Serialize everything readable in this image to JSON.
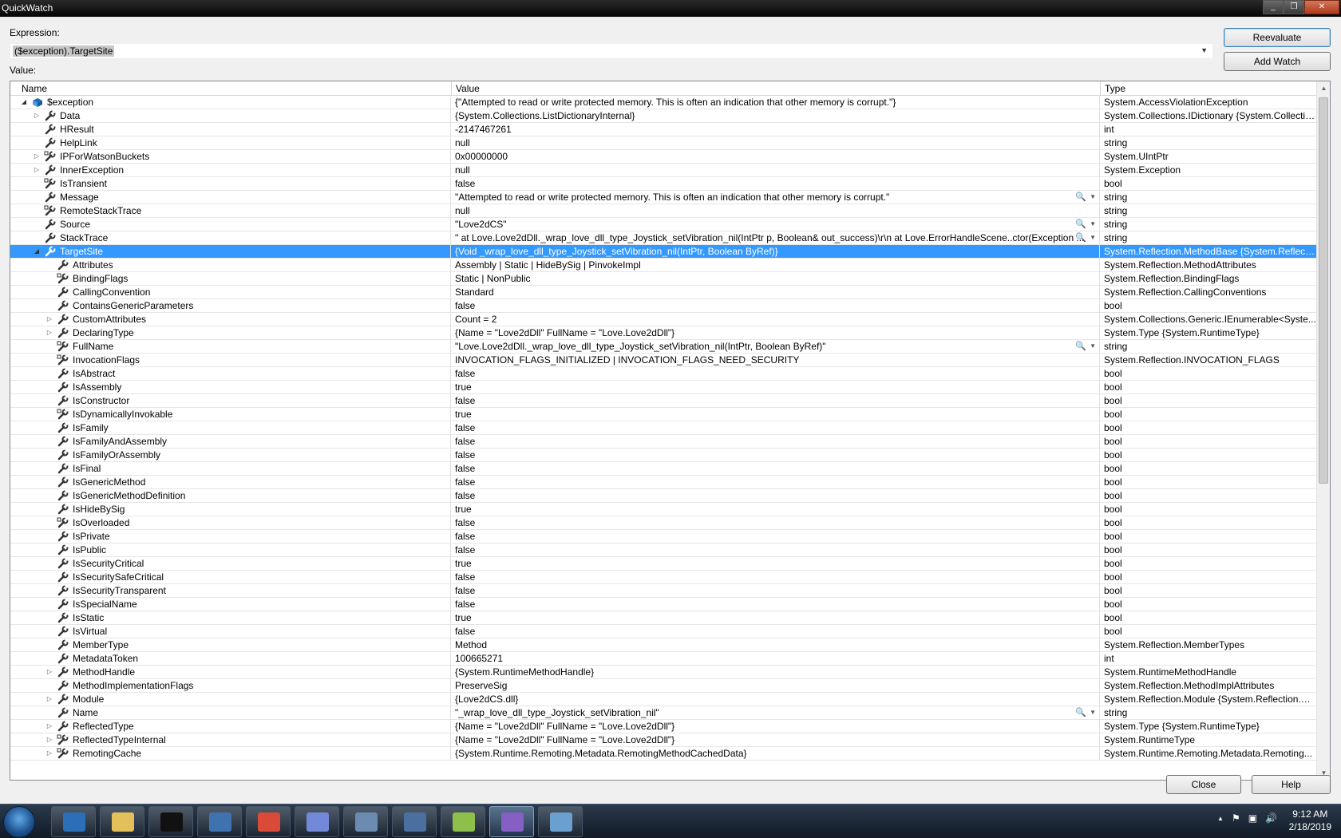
{
  "window": {
    "title": "QuickWatch",
    "btn_min": "_",
    "btn_max": "❐",
    "btn_close": "✕"
  },
  "expression": {
    "label": "Expression:",
    "value": "($exception).TargetSite"
  },
  "buttons": {
    "reevaluate": "Reevaluate",
    "add_watch": "Add Watch",
    "close": "Close",
    "help": "Help"
  },
  "value_label": "Value:",
  "columns": {
    "name": "Name",
    "value": "Value",
    "type": "Type"
  },
  "rows": [
    {
      "name": "$exception",
      "value": "{\"Attempted to read or write protected memory. This is often an indication that other memory is corrupt.\"}",
      "type": "System.AccessViolationException",
      "indent": 0,
      "expander": "open",
      "icon": "exception"
    },
    {
      "name": "Data",
      "value": "{System.Collections.ListDictionaryInternal}",
      "type": "System.Collections.IDictionary {System.Collectio...",
      "indent": 1,
      "expander": "closed",
      "icon": "property"
    },
    {
      "name": "HResult",
      "value": "-2147467261",
      "type": "int",
      "indent": 1,
      "expander": "",
      "icon": "property"
    },
    {
      "name": "HelpLink",
      "value": "null",
      "type": "string",
      "indent": 1,
      "expander": "",
      "icon": "property"
    },
    {
      "name": "IPForWatsonBuckets",
      "value": "0x00000000",
      "type": "System.UIntPtr",
      "indent": 1,
      "expander": "closed",
      "icon": "property-private"
    },
    {
      "name": "InnerException",
      "value": "null",
      "type": "System.Exception",
      "indent": 1,
      "expander": "closed",
      "icon": "property"
    },
    {
      "name": "IsTransient",
      "value": "false",
      "type": "bool",
      "indent": 1,
      "expander": "",
      "icon": "property-private"
    },
    {
      "name": "Message",
      "value": "\"Attempted to read or write protected memory. This is often an indication that other memory is corrupt.\"",
      "type": "string",
      "indent": 1,
      "expander": "",
      "icon": "property",
      "viz": true
    },
    {
      "name": "RemoteStackTrace",
      "value": "null",
      "type": "string",
      "indent": 1,
      "expander": "",
      "icon": "property-private"
    },
    {
      "name": "Source",
      "value": "\"Love2dCS\"",
      "type": "string",
      "indent": 1,
      "expander": "",
      "icon": "property",
      "viz": true
    },
    {
      "name": "StackTrace",
      "value": "\"   at Love.Love2dDll._wrap_love_dll_type_Joystick_setVibration_nil(IntPtr p, Boolean& out_success)\\r\\n   at Love.ErrorHandleScene..ctor(Exception ...",
      "type": "string",
      "indent": 1,
      "expander": "",
      "icon": "property",
      "viz": true
    },
    {
      "name": "TargetSite",
      "value": "{Void _wrap_love_dll_type_Joystick_setVibration_nil(IntPtr, Boolean ByRef)}",
      "type": "System.Reflection.MethodBase {System.Reflectio...",
      "indent": 1,
      "expander": "open",
      "icon": "property",
      "selected": true
    },
    {
      "name": "Attributes",
      "value": "Assembly | Static | HideBySig | PinvokeImpl",
      "type": "System.Reflection.MethodAttributes",
      "indent": 2,
      "expander": "",
      "icon": "property"
    },
    {
      "name": "BindingFlags",
      "value": "Static | NonPublic",
      "type": "System.Reflection.BindingFlags",
      "indent": 2,
      "expander": "",
      "icon": "property-private"
    },
    {
      "name": "CallingConvention",
      "value": "Standard",
      "type": "System.Reflection.CallingConventions",
      "indent": 2,
      "expander": "",
      "icon": "property"
    },
    {
      "name": "ContainsGenericParameters",
      "value": "false",
      "type": "bool",
      "indent": 2,
      "expander": "",
      "icon": "property"
    },
    {
      "name": "CustomAttributes",
      "value": "Count = 2",
      "type": "System.Collections.Generic.IEnumerable<Syste...",
      "indent": 2,
      "expander": "closed",
      "icon": "property"
    },
    {
      "name": "DeclaringType",
      "value": "{Name = \"Love2dDll\" FullName = \"Love.Love2dDll\"}",
      "type": "System.Type {System.RuntimeType}",
      "indent": 2,
      "expander": "closed",
      "icon": "property"
    },
    {
      "name": "FullName",
      "value": "\"Love.Love2dDll._wrap_love_dll_type_Joystick_setVibration_nil(IntPtr, Boolean ByRef)\"",
      "type": "string",
      "indent": 2,
      "expander": "",
      "icon": "property-private",
      "viz": true
    },
    {
      "name": "InvocationFlags",
      "value": "INVOCATION_FLAGS_INITIALIZED | INVOCATION_FLAGS_NEED_SECURITY",
      "type": "System.Reflection.INVOCATION_FLAGS",
      "indent": 2,
      "expander": "",
      "icon": "property-private"
    },
    {
      "name": "IsAbstract",
      "value": "false",
      "type": "bool",
      "indent": 2,
      "expander": "",
      "icon": "property"
    },
    {
      "name": "IsAssembly",
      "value": "true",
      "type": "bool",
      "indent": 2,
      "expander": "",
      "icon": "property"
    },
    {
      "name": "IsConstructor",
      "value": "false",
      "type": "bool",
      "indent": 2,
      "expander": "",
      "icon": "property"
    },
    {
      "name": "IsDynamicallyInvokable",
      "value": "true",
      "type": "bool",
      "indent": 2,
      "expander": "",
      "icon": "property-private"
    },
    {
      "name": "IsFamily",
      "value": "false",
      "type": "bool",
      "indent": 2,
      "expander": "",
      "icon": "property"
    },
    {
      "name": "IsFamilyAndAssembly",
      "value": "false",
      "type": "bool",
      "indent": 2,
      "expander": "",
      "icon": "property"
    },
    {
      "name": "IsFamilyOrAssembly",
      "value": "false",
      "type": "bool",
      "indent": 2,
      "expander": "",
      "icon": "property"
    },
    {
      "name": "IsFinal",
      "value": "false",
      "type": "bool",
      "indent": 2,
      "expander": "",
      "icon": "property"
    },
    {
      "name": "IsGenericMethod",
      "value": "false",
      "type": "bool",
      "indent": 2,
      "expander": "",
      "icon": "property"
    },
    {
      "name": "IsGenericMethodDefinition",
      "value": "false",
      "type": "bool",
      "indent": 2,
      "expander": "",
      "icon": "property"
    },
    {
      "name": "IsHideBySig",
      "value": "true",
      "type": "bool",
      "indent": 2,
      "expander": "",
      "icon": "property"
    },
    {
      "name": "IsOverloaded",
      "value": "false",
      "type": "bool",
      "indent": 2,
      "expander": "",
      "icon": "property-private"
    },
    {
      "name": "IsPrivate",
      "value": "false",
      "type": "bool",
      "indent": 2,
      "expander": "",
      "icon": "property"
    },
    {
      "name": "IsPublic",
      "value": "false",
      "type": "bool",
      "indent": 2,
      "expander": "",
      "icon": "property"
    },
    {
      "name": "IsSecurityCritical",
      "value": "true",
      "type": "bool",
      "indent": 2,
      "expander": "",
      "icon": "property"
    },
    {
      "name": "IsSecuritySafeCritical",
      "value": "false",
      "type": "bool",
      "indent": 2,
      "expander": "",
      "icon": "property"
    },
    {
      "name": "IsSecurityTransparent",
      "value": "false",
      "type": "bool",
      "indent": 2,
      "expander": "",
      "icon": "property"
    },
    {
      "name": "IsSpecialName",
      "value": "false",
      "type": "bool",
      "indent": 2,
      "expander": "",
      "icon": "property"
    },
    {
      "name": "IsStatic",
      "value": "true",
      "type": "bool",
      "indent": 2,
      "expander": "",
      "icon": "property"
    },
    {
      "name": "IsVirtual",
      "value": "false",
      "type": "bool",
      "indent": 2,
      "expander": "",
      "icon": "property"
    },
    {
      "name": "MemberType",
      "value": "Method",
      "type": "System.Reflection.MemberTypes",
      "indent": 2,
      "expander": "",
      "icon": "property"
    },
    {
      "name": "MetadataToken",
      "value": "100665271",
      "type": "int",
      "indent": 2,
      "expander": "",
      "icon": "property"
    },
    {
      "name": "MethodHandle",
      "value": "{System.RuntimeMethodHandle}",
      "type": "System.RuntimeMethodHandle",
      "indent": 2,
      "expander": "closed",
      "icon": "property"
    },
    {
      "name": "MethodImplementationFlags",
      "value": "PreserveSig",
      "type": "System.Reflection.MethodImplAttributes",
      "indent": 2,
      "expander": "",
      "icon": "property"
    },
    {
      "name": "Module",
      "value": "{Love2dCS.dll}",
      "type": "System.Reflection.Module {System.Reflection.Ru...",
      "indent": 2,
      "expander": "closed",
      "icon": "property"
    },
    {
      "name": "Name",
      "value": "\"_wrap_love_dll_type_Joystick_setVibration_nil\"",
      "type": "string",
      "indent": 2,
      "expander": "",
      "icon": "property",
      "viz": true
    },
    {
      "name": "ReflectedType",
      "value": "{Name = \"Love2dDll\" FullName = \"Love.Love2dDll\"}",
      "type": "System.Type {System.RuntimeType}",
      "indent": 2,
      "expander": "closed",
      "icon": "property"
    },
    {
      "name": "ReflectedTypeInternal",
      "value": "{Name = \"Love2dDll\" FullName = \"Love.Love2dDll\"}",
      "type": "System.RuntimeType",
      "indent": 2,
      "expander": "closed",
      "icon": "property-private"
    },
    {
      "name": "RemotingCache",
      "value": "{System.Runtime.Remoting.Metadata.RemotingMethodCachedData}",
      "type": "System.Runtime.Remoting.Metadata.Remoting...",
      "indent": 2,
      "expander": "closed",
      "icon": "property-private"
    }
  ],
  "taskbar": {
    "items": [
      {
        "name": "media-player-icon",
        "color": "#2b6fb8"
      },
      {
        "name": "file-explorer-icon",
        "color": "#e4c05a"
      },
      {
        "name": "command-prompt-icon",
        "color": "#111111"
      },
      {
        "name": "clock-app-icon",
        "color": "#3f73b0"
      },
      {
        "name": "chrome-icon",
        "color": "#d94a38"
      },
      {
        "name": "discord-icon",
        "color": "#7289da"
      },
      {
        "name": "calculator-icon",
        "color": "#6b8bb0"
      },
      {
        "name": "paint-tool-icon",
        "color": "#4a6fa0"
      },
      {
        "name": "notepad-plus-plus-icon",
        "color": "#8dbf4a"
      },
      {
        "name": "visual-studio-icon",
        "color": "#865fc5",
        "active": true
      },
      {
        "name": "window-app-icon",
        "color": "#6aa0d0"
      }
    ],
    "tray_up": "▲",
    "tray_flag": "⚑",
    "tray_network": "▣",
    "tray_volume": "🔊",
    "time": "9:12 AM",
    "date": "2/18/2019"
  }
}
